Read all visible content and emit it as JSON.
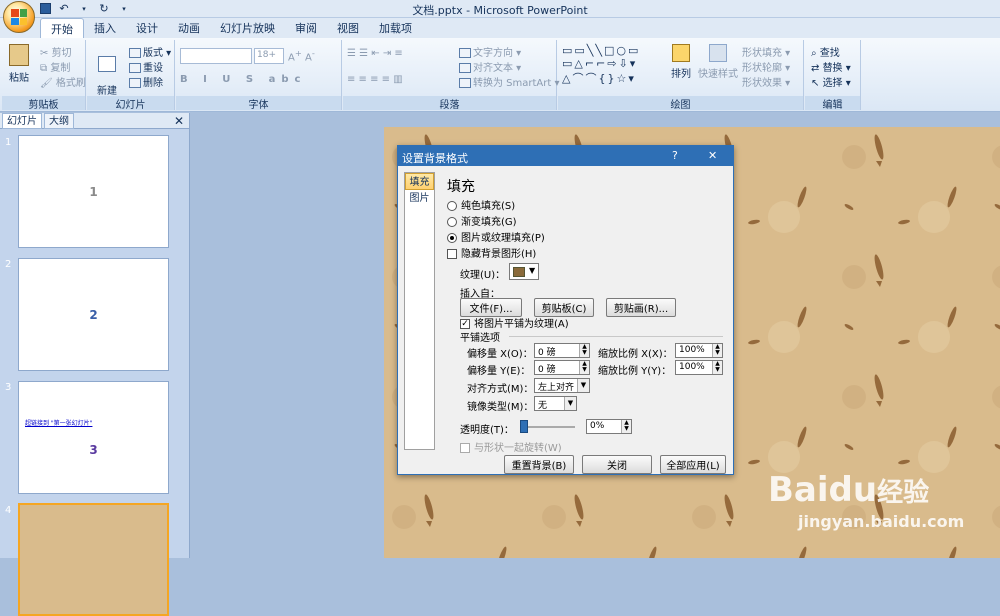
{
  "window": {
    "title": "文档.pptx - Microsoft PowerPoint"
  },
  "tabs": [
    "开始",
    "插入",
    "设计",
    "动画",
    "幻灯片放映",
    "审阅",
    "视图",
    "加载项"
  ],
  "ribbon": {
    "clipboard": {
      "name": "剪贴板",
      "paste": "粘贴",
      "cut": "剪切",
      "copy": "复制",
      "format_painter": "格式刷"
    },
    "slides": {
      "name": "幻灯片",
      "new_slide": "新建\n幻灯片",
      "layout": "版式",
      "reset": "重设",
      "delete": "删除"
    },
    "font": {
      "name": "字体",
      "size": "18+"
    },
    "paragraph": {
      "name": "段落",
      "text_direction": "文字方向",
      "align_text": "对齐文本",
      "smartart": "转换为 SmartArt"
    },
    "drawing": {
      "name": "绘图",
      "arrange": "排列",
      "quick_styles": "快速样式",
      "shape_fill": "形状填充",
      "shape_outline": "形状轮廓",
      "shape_effects": "形状效果"
    },
    "editing": {
      "name": "编辑",
      "find": "查找",
      "replace": "替换",
      "select": "选择"
    }
  },
  "pane": {
    "tab_slides": "幻灯片",
    "tab_outline": "大纲"
  },
  "thumbnails": [
    {
      "num": "1",
      "label": "1"
    },
    {
      "num": "2",
      "label": "2"
    },
    {
      "num": "3",
      "label": "3",
      "link": "超链接到 \"第一张幻灯片\""
    },
    {
      "num": "4",
      "label": ""
    }
  ],
  "dialog": {
    "title": "设置背景格式",
    "help": "?",
    "close": "✕",
    "nav": [
      "填充",
      "图片"
    ],
    "heading": "填充",
    "options": [
      {
        "label": "纯色填充(S)",
        "selected": false
      },
      {
        "label": "渐变填充(G)",
        "selected": false
      },
      {
        "label": "图片或纹理填充(P)",
        "selected": true
      }
    ],
    "hide_bg": "隐藏背景图形(H)",
    "texture_label": "纹理(U)：",
    "insert_from": "插入自：",
    "file_btn": "文件(F)...",
    "clipboard_btn": "剪贴板(C)",
    "clipart_btn": "剪贴画(R)...",
    "tile_check": "将图片平铺为纹理(A)",
    "tile_options": "平铺选项",
    "offset_x_label": "偏移量 X(O)：",
    "offset_x_value": "0 磅",
    "offset_y_label": "偏移量 Y(E)：",
    "offset_y_value": "0 磅",
    "scale_x_label": "缩放比例 X(X)：",
    "scale_x_value": "100%",
    "scale_y_label": "缩放比例 Y(Y)：",
    "scale_y_value": "100%",
    "align_label": "对齐方式(M)：",
    "align_value": "左上对齐",
    "mirror_label": "镜像类型(M)：",
    "mirror_value": "无",
    "transparency_label": "透明度(T)：",
    "transparency_value": "0%",
    "rotate_with_shape": "与形状一起旋转(W)",
    "reset_btn": "重置背景(B)",
    "close_btn": "关闭",
    "apply_all_btn": "全部应用(L)"
  },
  "watermark": {
    "brand": "Baidu",
    "brand_cn": "经验",
    "url": "jingyan.baidu.com"
  },
  "colors": {
    "dialog_title": "#2e6fb5",
    "slide_bg": "#d9bb8c",
    "pane": "#c3d4ec"
  }
}
